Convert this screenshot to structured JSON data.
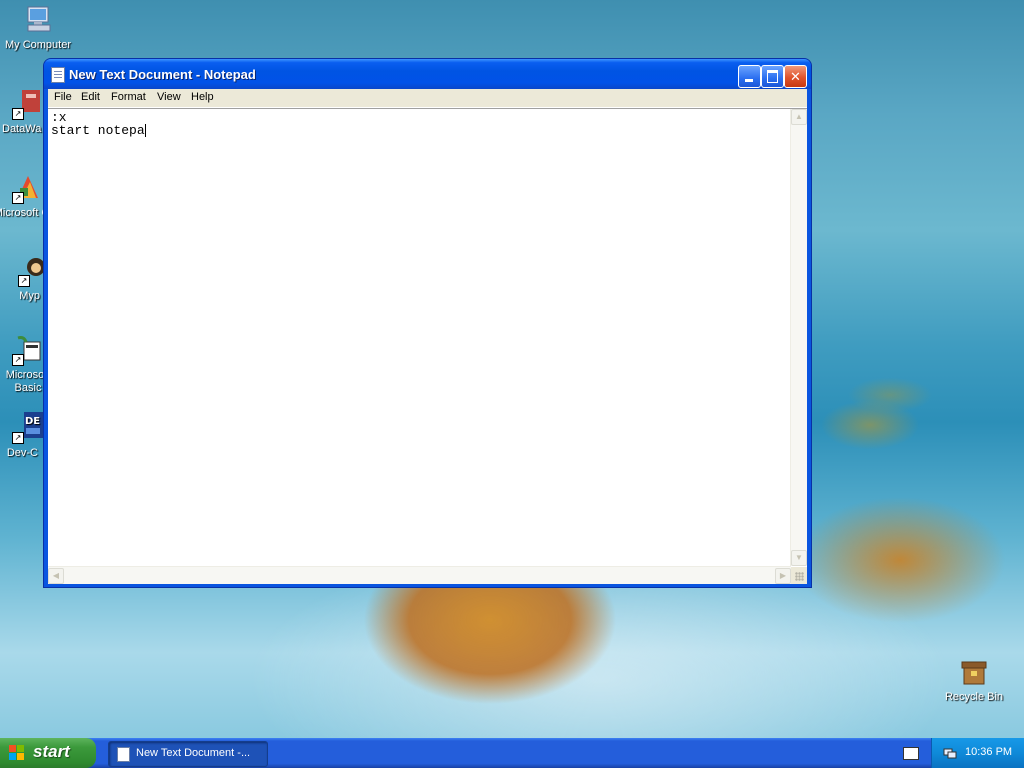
{
  "desktop": {
    "icons": [
      {
        "label": "My Computer",
        "icon": "my-computer-icon"
      },
      {
        "label": "DataWa",
        "icon": "datawarehouse-shortcut-icon"
      },
      {
        "label": "Microsoft C++",
        "icon": "visual-cpp-shortcut-icon"
      },
      {
        "label": "Myp",
        "icon": "myp-shortcut-icon"
      },
      {
        "label": "Microsoft Basic",
        "icon": "visual-basic-shortcut-icon"
      },
      {
        "label": "Dev-C",
        "icon": "dev-cpp-shortcut-icon"
      },
      {
        "label": "Recycle Bin",
        "icon": "recycle-bin-icon"
      }
    ]
  },
  "notepad": {
    "title": "New Text Document - Notepad",
    "menu": [
      "File",
      "Edit",
      "Format",
      "View",
      "Help"
    ],
    "content_lines": [
      ":x",
      "start notepa"
    ],
    "buttons": {
      "minimize": "minimize",
      "maximize": "maximize",
      "close": "close"
    }
  },
  "taskbar": {
    "start_label": "start",
    "task_button_label": "New Text Document -...",
    "clock": "10:36 PM"
  },
  "colors": {
    "titlebar": "#0054e3",
    "start_button": "#3c9a3c",
    "taskbar": "#245edb",
    "tray": "#0f8ad9"
  }
}
